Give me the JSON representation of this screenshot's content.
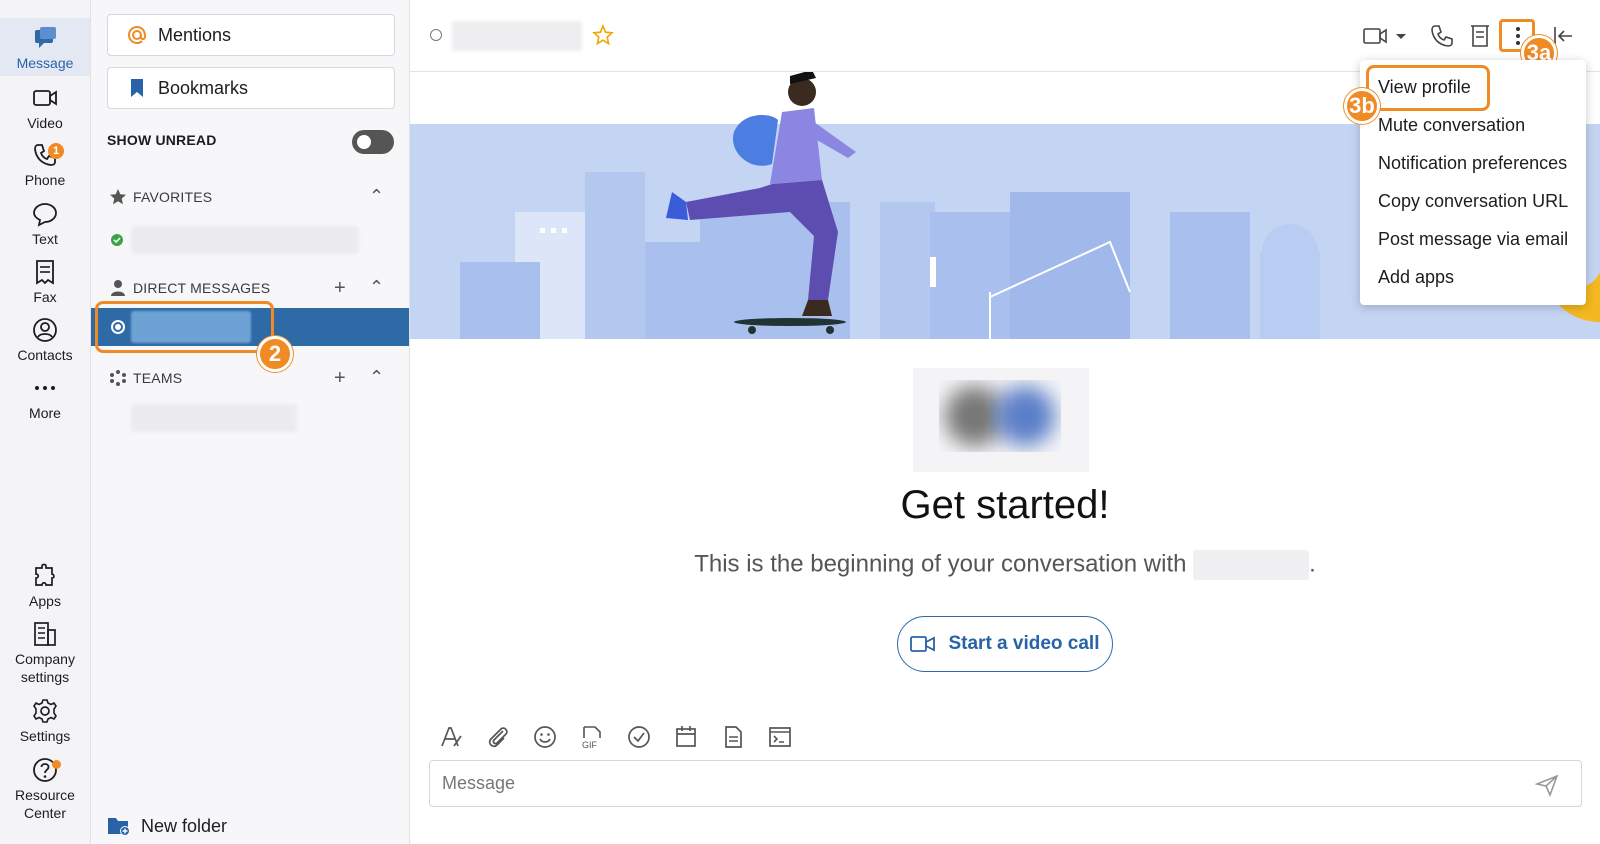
{
  "rail": {
    "items": [
      {
        "label": "Message",
        "icon": "message-icon"
      },
      {
        "label": "Video",
        "icon": "video-icon"
      },
      {
        "label": "Phone",
        "icon": "phone-icon",
        "badge": "1"
      },
      {
        "label": "Text",
        "icon": "text-bubble-icon"
      },
      {
        "label": "Fax",
        "icon": "fax-icon"
      },
      {
        "label": "Contacts",
        "icon": "contacts-icon"
      },
      {
        "label": "More",
        "icon": "more-dots-icon"
      }
    ],
    "bottom": [
      {
        "label": "Apps",
        "icon": "apps-puzzle-icon"
      },
      {
        "label": "Company settings",
        "icon": "company-settings-icon"
      },
      {
        "label": "Settings",
        "icon": "gear-icon"
      },
      {
        "label": "Resource Center",
        "icon": "help-icon"
      }
    ]
  },
  "sidebar": {
    "mentions": "Mentions",
    "bookmarks": "Bookmarks",
    "show_unread": "SHOW UNREAD",
    "favorites": "FAVORITES",
    "direct_messages": "DIRECT MESSAGES",
    "teams": "TEAMS",
    "new_folder": "New folder"
  },
  "main": {
    "get_started": "Get started!",
    "beginning": "This is the beginning of your conversation with",
    "beginning_end": ".",
    "video_call": "Start a video call",
    "message_placeholder": "Message"
  },
  "menu": {
    "items": [
      "View profile",
      "Mute conversation",
      "Notification preferences",
      "Copy conversation URL",
      "Post message via email",
      "Add apps"
    ]
  },
  "callouts": {
    "step_2": "2",
    "step_3a": "3a",
    "step_3b": "3b"
  },
  "colors": {
    "accent": "#2e6aa6",
    "callout": "#f08a24",
    "status_green": "#3aa34a"
  }
}
